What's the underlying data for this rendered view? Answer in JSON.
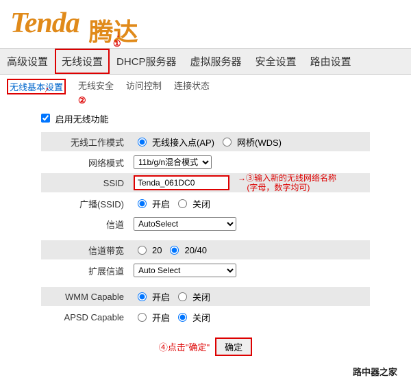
{
  "logo": {
    "en": "Tenda",
    "cn": "腾达"
  },
  "annotations": {
    "a1": "①",
    "a2": "②",
    "a3_arrow": "→",
    "a3_circ": "③",
    "a3_line1": "输入新的无线网络名称",
    "a3_line2": "(字母，数字均可)",
    "a4": "④点击\"确定\""
  },
  "mainTabs": [
    "高级设置",
    "无线设置",
    "DHCP服务器",
    "虚拟服务器",
    "安全设置",
    "路由设置"
  ],
  "subTabs": [
    "无线基本设置",
    "无线安全",
    "访问控制",
    "连接状态"
  ],
  "enable_label": "启用无线功能",
  "labels": {
    "work_mode": "无线工作模式",
    "net_mode": "网络模式",
    "ssid": "SSID",
    "broadcast": "广播(SSID)",
    "channel": "信道",
    "bandwidth": "信道带宽",
    "ext_channel": "扩展信道",
    "wmm": "WMM Capable",
    "apsd": "APSD Capable"
  },
  "options": {
    "ap": "无线接入点(AP)",
    "wds": "网桥(WDS)",
    "open": "开启",
    "close": "关闭",
    "bw20": "20",
    "bw2040": "20/40"
  },
  "values": {
    "net_mode": "11b/g/n混合模式",
    "ssid": "Tenda_061DC0",
    "channel": "AutoSelect",
    "ext_channel": "Auto Select"
  },
  "buttons": {
    "ok": "确定"
  },
  "footer": "路中器之家"
}
